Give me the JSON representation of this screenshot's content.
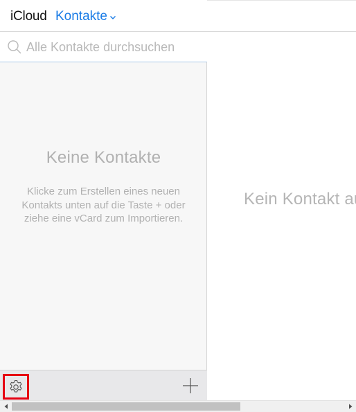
{
  "header": {
    "brand": "iCloud",
    "app_name": "Kontakte"
  },
  "search": {
    "placeholder": "Alle Kontakte durchsuchen"
  },
  "empty_state": {
    "title": "Keine Kontakte",
    "text": "Klicke zum Erstellen eines neuen Kontakts unten auf die Taste + oder ziehe eine vCard zum Importieren."
  },
  "detail": {
    "empty_text": "Kein Kontakt ausgewählt"
  },
  "footer": {
    "settings_icon": "gear-icon",
    "add_icon": "plus-icon"
  },
  "colors": {
    "accent": "#1a7ce6",
    "highlight": "#e60012",
    "muted_text": "#b1b1b1"
  }
}
